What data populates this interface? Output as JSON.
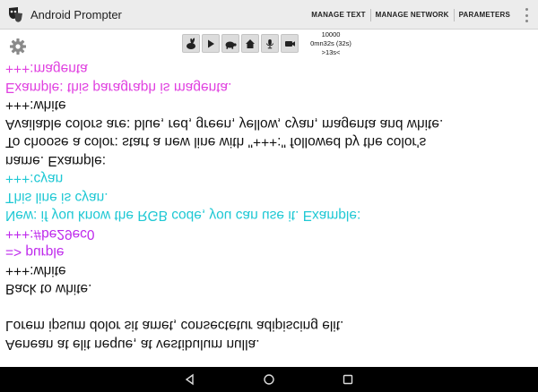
{
  "app": {
    "title": "Android Prompter",
    "menu": [
      "MANAGE TEXT",
      "MANAGE NETWORK",
      "PARAMETERS"
    ]
  },
  "icons": {
    "logo": "theater-mask-icon",
    "settings": "gear-icon",
    "overflow": "more-vert-icon",
    "toolbar": [
      "rabbit-icon",
      "play-icon",
      "turtle-icon",
      "home-icon",
      "microphone-icon",
      "camera-icon"
    ],
    "nav": [
      "back-icon",
      "home-icon",
      "recents-icon"
    ]
  },
  "stats": {
    "count": "10000",
    "time": "0mn32s (32s)",
    "marker": ">13s<"
  },
  "colors": {
    "text": "#111111",
    "purple": "#be29ec",
    "cyan": "#1fc8d4",
    "magenta": "#e040e0",
    "appbar": "#ececec",
    "navbar": "#000000"
  },
  "prompter": {
    "lines": [
      {
        "text": "Aenean at elit neque, at vestibulum nulla.",
        "color": "#111111"
      },
      {
        "text": "Lorem ipsum dolor sit amet, consectetur adipiscing elit.",
        "color": "#111111"
      },
      {
        "text": "",
        "color": "#111111"
      },
      {
        "text": "Back to white.",
        "color": "#111111"
      },
      {
        "text": "+++:white",
        "color": "#111111"
      },
      {
        "text": "=> purple",
        "color": "#be29ec"
      },
      {
        "text": "+++:#be29ec0",
        "color": "#be29ec"
      },
      {
        "text": "New: if you know the RGB code, you can use it. Example:",
        "color": "#1fc8d4"
      },
      {
        "text": "This line is cyan.",
        "color": "#1fc8d4"
      },
      {
        "text": "+++:cyan",
        "color": "#1fc8d4"
      },
      {
        "text": "name. Example:",
        "color": "#111111"
      },
      {
        "text": "To choose a color: start a new line with \"+++:\" followed by the color's",
        "color": "#111111"
      },
      {
        "text": "Available colors are: blue, red, green, yellow, cyan, magenta and white.",
        "color": "#111111"
      },
      {
        "text": "+++:white",
        "color": "#111111"
      },
      {
        "text": "Example: this paragraph is magenta.",
        "color": "#e040e0"
      },
      {
        "text": "+++:magenta",
        "color": "#e040e0"
      }
    ]
  }
}
